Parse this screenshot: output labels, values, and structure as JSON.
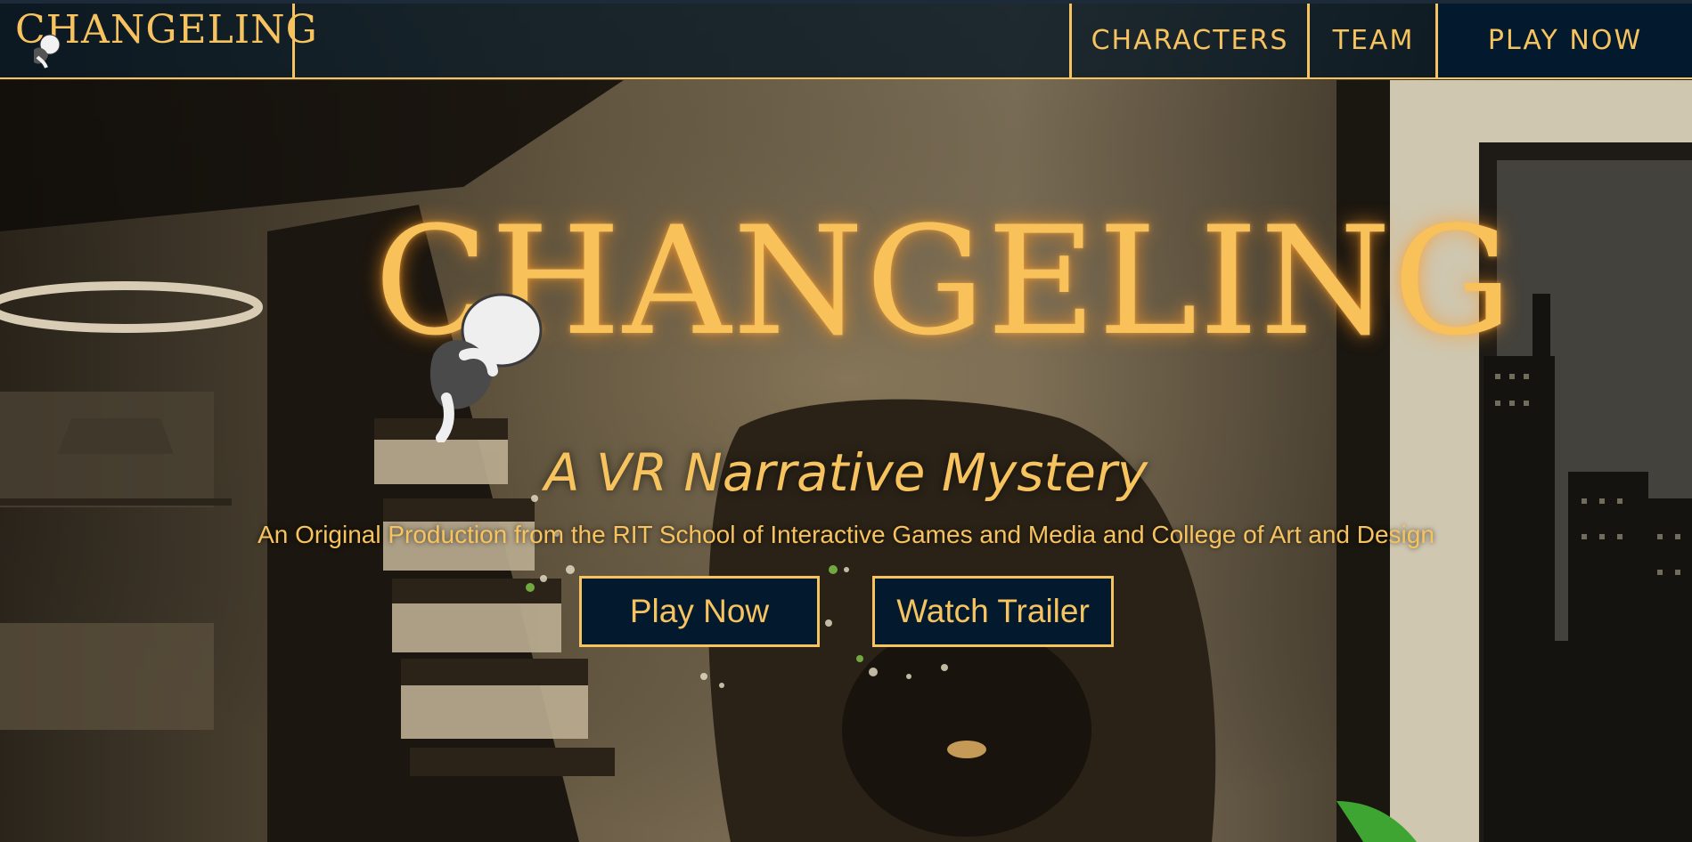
{
  "nav": {
    "brand": "CHANGELING",
    "items": [
      {
        "label": "CHARACTERS"
      },
      {
        "label": "TEAM"
      },
      {
        "label": "PLAY NOW"
      }
    ]
  },
  "hero": {
    "logo_text": "CHANGELING",
    "tagline": "A VR Narrative Mystery",
    "subline": "An Original Production from the RIT School of Interactive Games and Media and College of Art and Design",
    "buttons": {
      "play": "Play Now",
      "trailer": "Watch Trailer"
    }
  },
  "colors": {
    "accent": "#f7c35f",
    "nav_bg": "#031a2e"
  }
}
